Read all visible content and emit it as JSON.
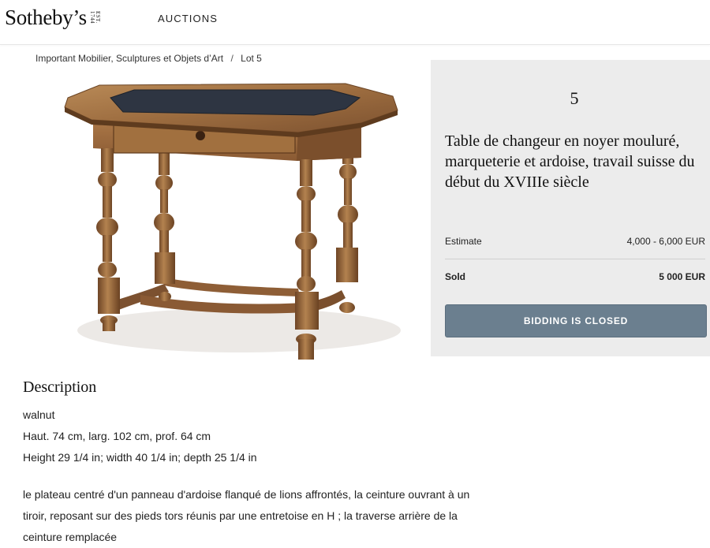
{
  "header": {
    "logo_text": "Sotheby’s",
    "logo_est": "EST. 1744",
    "nav_auctions": "AUCTIONS"
  },
  "breadcrumb": {
    "sale": "Important Mobilier, Sculptures et Objets d’Art",
    "separator": "/",
    "lot": "Lot 5"
  },
  "image": {
    "subject": "walnut table with slate top"
  },
  "lot": {
    "number": "5",
    "title": "Table de changeur en noyer mouluré, marqueterie et ardoise, travail suisse du début du XVIIIe siècle",
    "estimate_label": "Estimate",
    "estimate_value": "4,000 - 6,000 EUR",
    "sold_label": "Sold",
    "sold_value": "5 000 EUR",
    "bid_button": "BIDDING IS CLOSED"
  },
  "description": {
    "heading": "Description",
    "lines": [
      "walnut",
      "Haut. 74 cm, larg. 102 cm, prof. 64 cm",
      "Height 29 1/4 in; width 40 1/4 in; depth 25 1/4 in"
    ],
    "paragraph": "le plateau centré d'un panneau d'ardoise flanqué de lions affrontés, la ceinture ouvrant à un tiroir, reposant sur des pieds tors réunis par une entretoise en H ; la traverse arrière de la ceinture remplacée"
  },
  "colors": {
    "panel_bg": "#ececec",
    "button_bg": "#6b7f8f",
    "wood": "#9a6a3f",
    "slate": "#2e3542"
  }
}
